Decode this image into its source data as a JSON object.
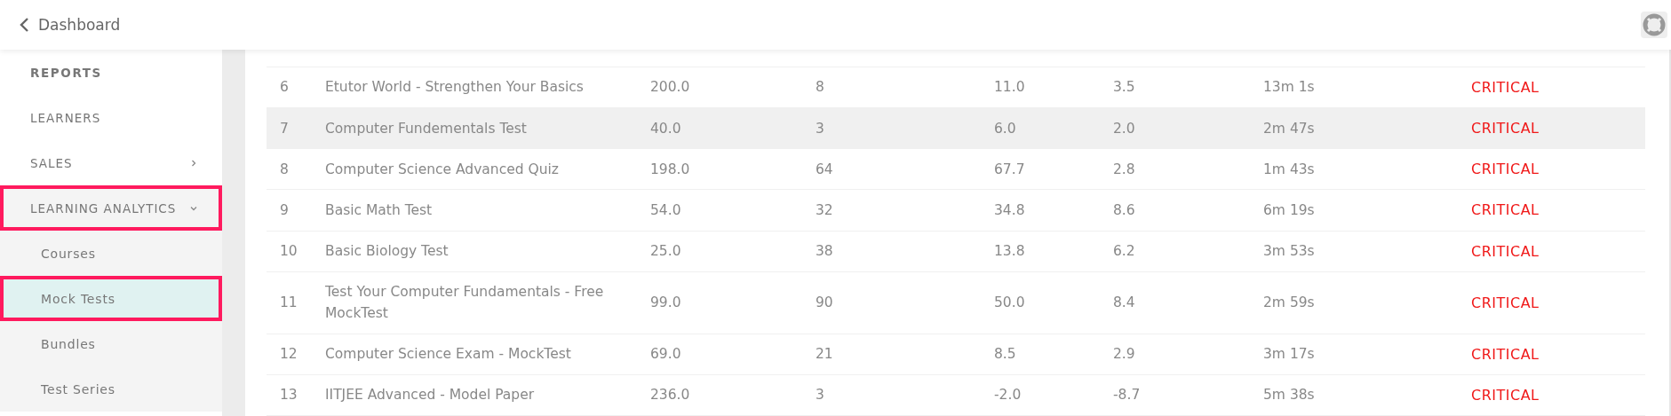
{
  "header": {
    "back_label": "Dashboard"
  },
  "sidebar": {
    "items": [
      {
        "kind": "heading",
        "label": "REPORTS"
      },
      {
        "kind": "item",
        "label": "LEARNERS"
      },
      {
        "kind": "item",
        "label": "SALES",
        "expanded": false
      },
      {
        "kind": "item",
        "label": "LEARNING ANALYTICS",
        "expanded": true,
        "highlighted": true,
        "children": [
          {
            "label": "Courses",
            "selected": false,
            "highlighted": false
          },
          {
            "label": "Mock Tests",
            "selected": true,
            "highlighted": true
          },
          {
            "label": "Bundles",
            "selected": false,
            "highlighted": false
          },
          {
            "label": "Test Series",
            "selected": false,
            "highlighted": false
          }
        ]
      }
    ]
  },
  "table": {
    "rows": [
      {
        "cells": [
          "6",
          "Etutor World - Strengthen Your Basics",
          "200.0",
          "8",
          "11.0",
          "3.5",
          "13m 1s"
        ],
        "status": "CRITICAL",
        "highlighted": false
      },
      {
        "cells": [
          "7",
          "Computer Fundementals Test",
          "40.0",
          "3",
          "6.0",
          "2.0",
          "2m 47s"
        ],
        "status": "CRITICAL",
        "highlighted": true
      },
      {
        "cells": [
          "8",
          "Computer Science Advanced Quiz",
          "198.0",
          "64",
          "67.7",
          "2.8",
          "1m 43s"
        ],
        "status": "CRITICAL",
        "highlighted": false
      },
      {
        "cells": [
          "9",
          "Basic Math Test",
          "54.0",
          "32",
          "34.8",
          "8.6",
          "6m 19s"
        ],
        "status": "CRITICAL",
        "highlighted": false
      },
      {
        "cells": [
          "10",
          "Basic Biology Test",
          "25.0",
          "38",
          "13.8",
          "6.2",
          "3m 53s"
        ],
        "status": "CRITICAL",
        "highlighted": false
      },
      {
        "cells": [
          "11",
          "Test Your Computer Fundamentals - Free MockTest",
          "99.0",
          "90",
          "50.0",
          "8.4",
          "2m 59s"
        ],
        "status": "CRITICAL",
        "highlighted": false
      },
      {
        "cells": [
          "12",
          "Computer Science Exam - MockTest",
          "69.0",
          "21",
          "8.5",
          "2.9",
          "3m 17s"
        ],
        "status": "CRITICAL",
        "highlighted": false
      },
      {
        "cells": [
          "13",
          "IITJEE Advanced - Model Paper",
          "236.0",
          "3",
          "-2.0",
          "-8.7",
          "5m 38s"
        ],
        "status": "CRITICAL",
        "highlighted": false
      }
    ]
  }
}
